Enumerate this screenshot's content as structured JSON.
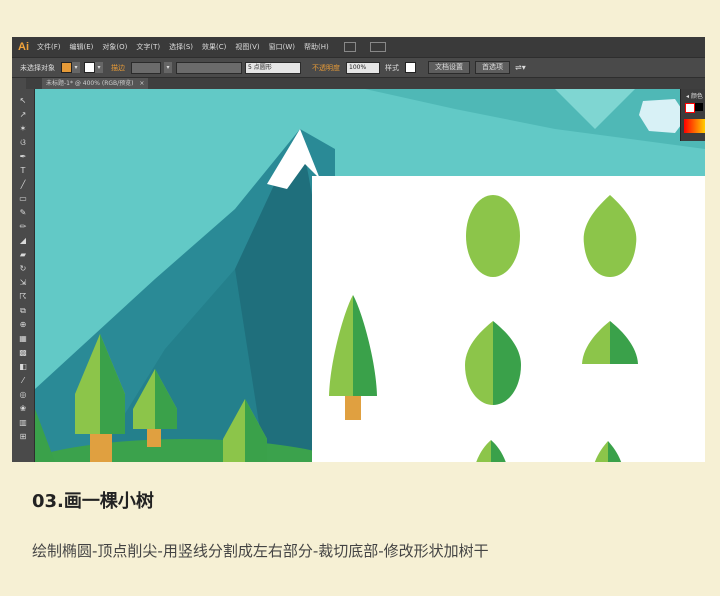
{
  "app": {
    "logo": "Ai"
  },
  "menu": [
    "文件(F)",
    "编辑(E)",
    "对象(O)",
    "文字(T)",
    "选择(S)",
    "效果(C)",
    "视图(V)",
    "窗口(W)",
    "帮助(H)"
  ],
  "control_bar": {
    "selection_label": "未选择对象",
    "stroke_label": "描边",
    "brush_label": "5 点圆形",
    "opacity_label": "不透明度",
    "opacity_value": "100%",
    "style_label": "样式",
    "doc_settings_button": "文档设置",
    "preferences_button": "首选项",
    "fill_color": "#e59a38"
  },
  "document_tab": {
    "title": "未标题-1* @ 400% (RGB/预览)",
    "close": "×"
  },
  "color_panel": {
    "title": "颜色"
  },
  "palette": {
    "bg_teal": "#5ec6c3",
    "mountain_dark": "#1f6f7c",
    "mountain_mid": "#2a8a96",
    "snow": "#ffffff",
    "leaf_light": "#8cc54a",
    "leaf_dark": "#3aa14a",
    "trunk": "#e0a040"
  },
  "caption": {
    "heading": "03.画一棵小树",
    "description": "绘制椭圆-顶点削尖-用竖线分割成左右部分-裁切底部-修改形状加树干"
  }
}
